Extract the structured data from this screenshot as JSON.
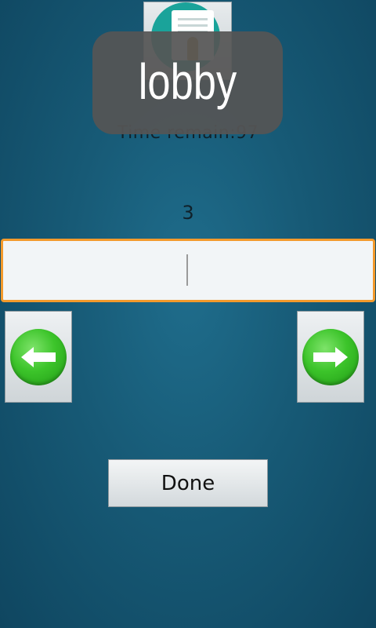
{
  "top_image_button": {
    "icon": "document-person-icon"
  },
  "timer": {
    "text": "Time remain:97"
  },
  "toast": {
    "text": "lobby"
  },
  "question": {
    "number": "3"
  },
  "answer_input": {
    "value": "",
    "placeholder": ""
  },
  "navigation": {
    "prev_icon": "arrow-left-icon",
    "next_icon": "arrow-right-icon"
  },
  "actions": {
    "done_label": "Done"
  },
  "colors": {
    "background": "#175a76",
    "input_border": "#f39a2c",
    "arrow_green": "#3cc42a",
    "toast_bg": "#555555"
  }
}
